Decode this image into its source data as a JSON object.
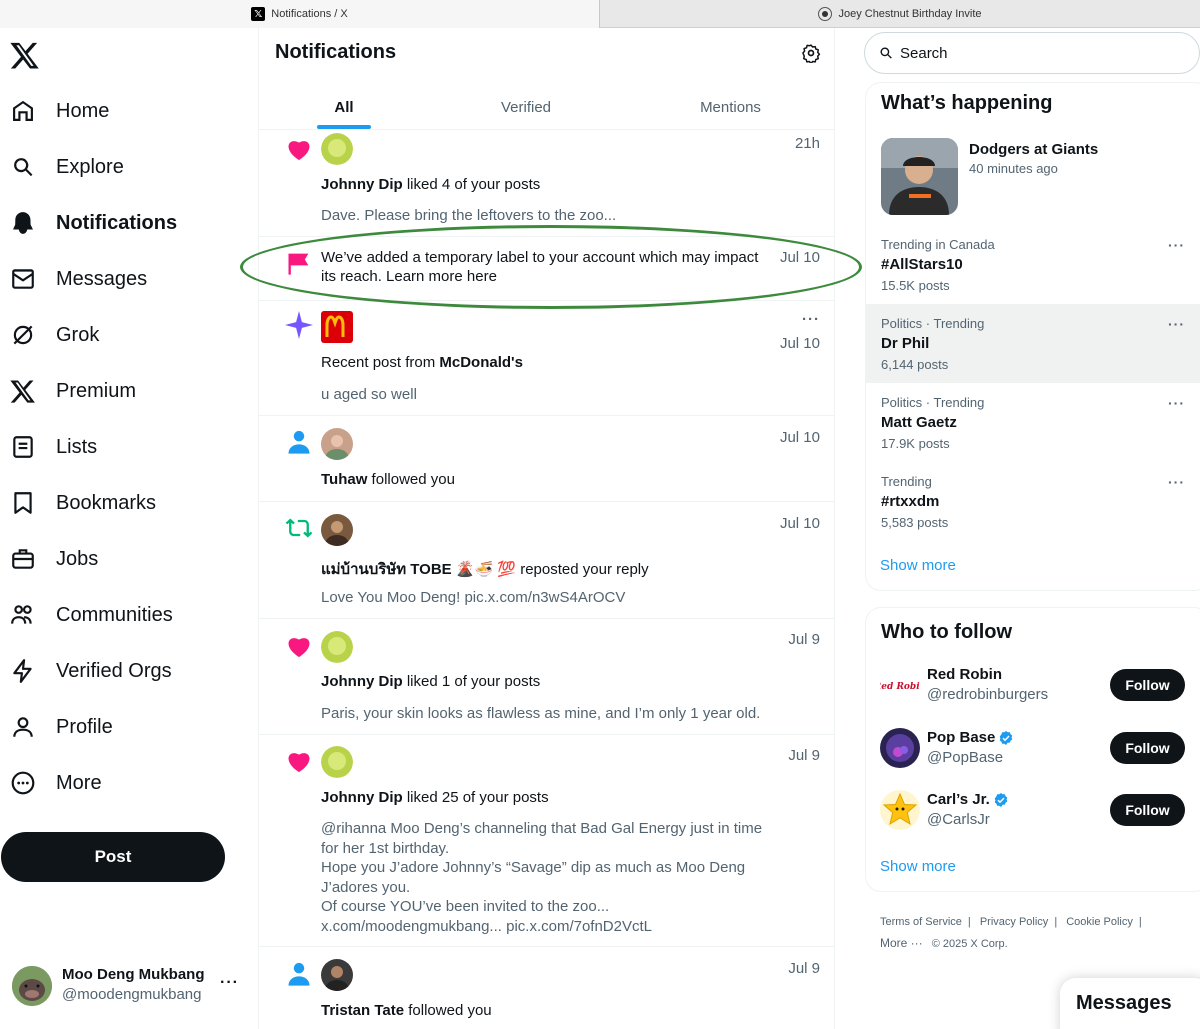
{
  "browser": {
    "tabs": [
      {
        "title": "Notifications / X",
        "active": true
      },
      {
        "title": "Joey Chestnut Birthday Invite",
        "active": false
      }
    ]
  },
  "nav": {
    "items": [
      {
        "label": "Home",
        "icon": "home-icon"
      },
      {
        "label": "Explore",
        "icon": "search-icon"
      },
      {
        "label": "Notifications",
        "icon": "bell-icon"
      },
      {
        "label": "Messages",
        "icon": "envelope-icon"
      },
      {
        "label": "Grok",
        "icon": "grok-icon"
      },
      {
        "label": "Premium",
        "icon": "x-icon"
      },
      {
        "label": "Lists",
        "icon": "list-icon"
      },
      {
        "label": "Bookmarks",
        "icon": "bookmark-icon"
      },
      {
        "label": "Jobs",
        "icon": "briefcase-icon"
      },
      {
        "label": "Communities",
        "icon": "people-icon"
      },
      {
        "label": "Verified Orgs",
        "icon": "lightning-icon"
      },
      {
        "label": "Profile",
        "icon": "person-icon"
      },
      {
        "label": "More",
        "icon": "more-circle-icon"
      }
    ],
    "post_label": "Post"
  },
  "account": {
    "name": "Moo Deng Mukbang",
    "handle": "@moodengmukbang",
    "more": "···"
  },
  "main": {
    "title": "Notifications",
    "tabs": [
      "All",
      "Verified",
      "Mentions"
    ],
    "selected_tab": "All",
    "notifications": [
      {
        "type": "like",
        "time": "21h",
        "actor": "Johnny Dip",
        "action": " liked 4 of your posts",
        "preview": [
          "Dave. Please bring the leftovers to the zoo..."
        ]
      },
      {
        "type": "label",
        "time": "Jul 10",
        "text1": "We’ve added a temporary label to your account which may impact",
        "text2": "its reach. Learn more here"
      },
      {
        "type": "recent",
        "time": "Jul 10",
        "more": "···",
        "prefix": "Recent post from ",
        "actor": "McDonald's",
        "preview": [
          "u aged so well"
        ]
      },
      {
        "type": "follow",
        "time": "Jul 10",
        "actor": "Tuhaw",
        "action": " followed you"
      },
      {
        "type": "repost",
        "time": "Jul 10",
        "actor": "แม่บ้านบริษัท TOBE 🌋🍜 💯",
        "action": " reposted your reply",
        "preview": [
          "Love You Moo Deng! pic.x.com/n3wS4ArOCV"
        ]
      },
      {
        "type": "like",
        "time": "Jul 9",
        "actor": "Johnny Dip",
        "action": " liked 1 of your posts",
        "preview": [
          "Paris, your skin looks as flawless as mine, and I’m only 1 year old."
        ]
      },
      {
        "type": "like",
        "time": "Jul 9",
        "actor": "Johnny Dip",
        "action": " liked 25 of your posts",
        "preview": [
          "@rihanna Moo Deng’s channeling that Bad Gal Energy just in time",
          "for her 1st birthday.",
          "Hope you J’adore Johnny’s “Savage” dip as much as Moo Deng",
          "J’adores you.",
          "Of course YOU’ve been invited to the zoo...",
          "x.com/moodengmukbang... pic.x.com/7ofnD2VctL"
        ]
      },
      {
        "type": "follow",
        "time": "Jul 9",
        "actor": "Tristan Tate",
        "action": " followed you"
      }
    ]
  },
  "right": {
    "search_placeholder": "Search",
    "happening": {
      "title": "What’s happening",
      "featured": {
        "title": "Dodgers at Giants",
        "meta": "40 minutes ago"
      },
      "trends": [
        {
          "context": "Trending in Canada",
          "title": "#AllStars10",
          "count": "15.5K posts"
        },
        {
          "context": "Politics · Trending",
          "title": "Dr Phil",
          "count": "6,144 posts"
        },
        {
          "context": "Politics · Trending",
          "title": "Matt Gaetz",
          "count": "17.9K posts"
        },
        {
          "context": "Trending",
          "title": "#rtxxdm",
          "count": "5,583 posts"
        }
      ],
      "show_more": "Show more"
    },
    "who_to_follow": {
      "title": "Who to follow",
      "accounts": [
        {
          "name": "Red Robin",
          "handle": "@redrobinburgers",
          "verified": false,
          "logo_text": "Red Robin"
        },
        {
          "name": "Pop Base",
          "handle": "@PopBase",
          "verified": true
        },
        {
          "name": "Carl’s Jr.",
          "handle": "@CarlsJr",
          "verified": true
        }
      ],
      "follow_label": "Follow",
      "show_more": "Show more"
    },
    "footer": {
      "links": [
        "Terms of Service",
        "Privacy Policy",
        "Cookie Policy"
      ],
      "more": "More ···",
      "copyright": "© 2025 X Corp."
    },
    "messages_drawer": "Messages"
  },
  "colors": {
    "accent": "#1d9bf0",
    "like": "#f91880",
    "repost": "#00ba7c",
    "grok": "#7856ff",
    "highlight_ellipse": "#3d8a3d"
  }
}
